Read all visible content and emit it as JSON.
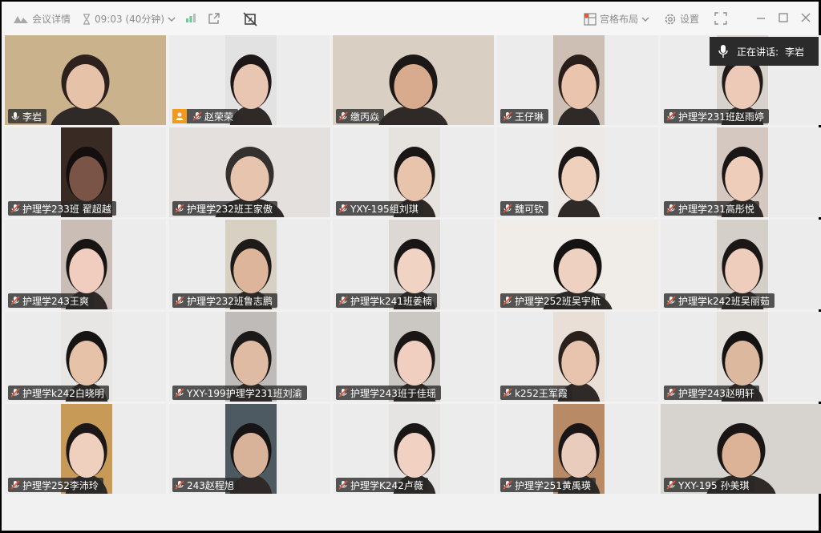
{
  "topbar": {
    "meeting_details": "会议详情",
    "timer": "09:03 (40分钟)",
    "layout": "宫格布局",
    "settings": "设置"
  },
  "speaking": {
    "label": "正在讲话:",
    "name": "李岩"
  },
  "participants": [
    {
      "name": "李岩",
      "mic": "on"
    },
    {
      "name": "赵荣荣",
      "mic": "muted",
      "host": true
    },
    {
      "name": "缴丙焱",
      "mic": "muted"
    },
    {
      "name": "王仔琳",
      "mic": "muted"
    },
    {
      "name": "护理学231班赵雨婷",
      "mic": "muted"
    },
    {
      "name": "护理学233班 翟超越",
      "mic": "muted"
    },
    {
      "name": "护理学232班王家傲",
      "mic": "muted"
    },
    {
      "name": "YXY-195组刘琪",
      "mic": "muted"
    },
    {
      "name": "魏可钦",
      "mic": "muted"
    },
    {
      "name": "护理学231高彤悦",
      "mic": "muted"
    },
    {
      "name": "护理学243王爽",
      "mic": "muted"
    },
    {
      "name": "护理学232班鲁志鹏",
      "mic": "muted"
    },
    {
      "name": "护理学k241班姜楠",
      "mic": "muted"
    },
    {
      "name": "护理学252班吴宇航",
      "mic": "muted"
    },
    {
      "name": "护理学k242班吴丽茹",
      "mic": "muted"
    },
    {
      "name": "护理学k242白晓明",
      "mic": "muted"
    },
    {
      "name": "YXY-199护理学231班刘渝",
      "mic": "muted"
    },
    {
      "name": "护理学243班于佳瑶",
      "mic": "muted"
    },
    {
      "name": "k252王军霞",
      "mic": "muted"
    },
    {
      "name": "护理学243赵明轩",
      "mic": "muted"
    },
    {
      "name": "护理学252李沛玲",
      "mic": "muted"
    },
    {
      "name": "243赵程旭",
      "mic": "muted"
    },
    {
      "name": "护理学K242卢薇",
      "mic": "muted"
    },
    {
      "name": "护理学251黄禹瑛",
      "mic": "muted"
    },
    {
      "name": "YXY-195 孙美琪",
      "mic": "muted"
    }
  ],
  "colors": {
    "accent_green": "#62c28c",
    "host_badge": "#f39a1e",
    "muted_icon": "#e0573a"
  }
}
